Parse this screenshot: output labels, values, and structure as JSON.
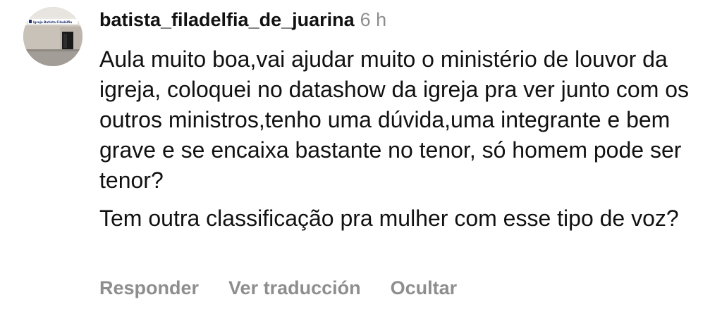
{
  "comment": {
    "avatar_icon": "church-building-avatar",
    "avatar_sign_text": "Igreja Batista Filadélfia",
    "username": "batista_filadelfia_de_juarina",
    "time": "6 h",
    "paragraphs": [
      "Aula muito boa,vai ajudar muito o ministério de louvor da igreja, coloquei no datashow da igreja pra ver junto com os outros ministros,tenho uma dúvida,uma integrante e bem grave e se encaixa bastante no tenor, só homem pode ser tenor?",
      "Tem outra classificação pra mulher com esse tipo de voz?"
    ],
    "actions": {
      "reply": "Responder",
      "translate": "Ver traducción",
      "hide": "Ocultar"
    }
  },
  "colors": {
    "text": "#111111",
    "muted": "#8e8e8e",
    "background": "#ffffff"
  }
}
